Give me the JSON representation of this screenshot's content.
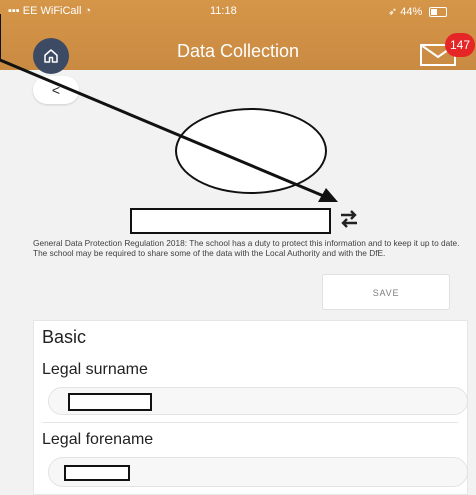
{
  "status_bar": {
    "carrier": "EE WiFiCall",
    "time": "11:18",
    "battery": "44%"
  },
  "header": {
    "title": "Data Collection",
    "mail_badge": "147"
  },
  "privacy_notice": "General Data Protection Regulation 2018: The school has a duty to protect this information and to keep it up to date. The school may be required to share some of the data with the Local Authority and with the DfE.",
  "actions": {
    "save_label": "SAVE"
  },
  "basic_section": {
    "title": "Basic",
    "surname_label": "Legal surname",
    "forename_label": "Legal forename"
  },
  "colors": {
    "header_accent": "#cf8f45",
    "home_button": "#3d4a63",
    "badge": "#e62626"
  },
  "icons": {
    "home": "home-icon",
    "mail": "mail-icon",
    "back": "chevron-left-icon",
    "swap": "swap-arrows-icon"
  }
}
